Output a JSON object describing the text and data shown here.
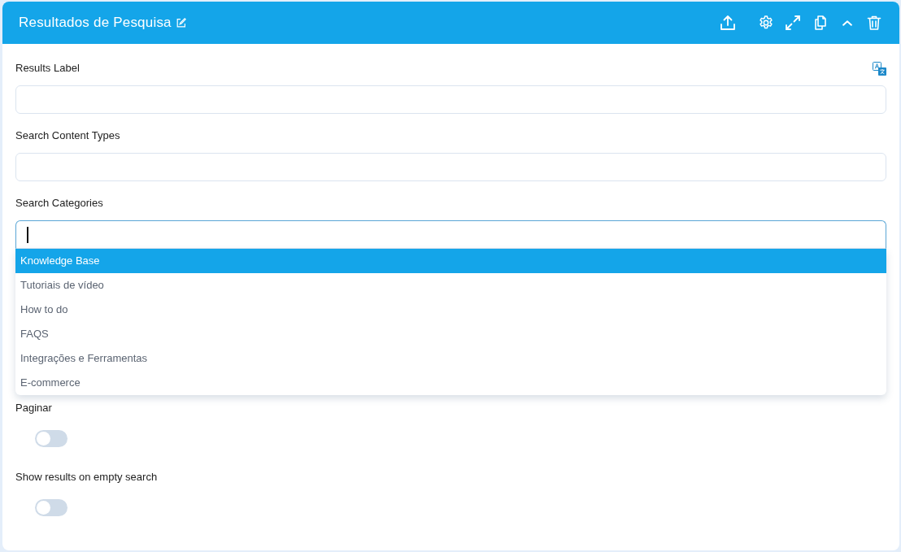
{
  "header": {
    "title": "Resultados de Pesquisa"
  },
  "fields": [
    {
      "kind": "text",
      "label": "Results Label",
      "translate": true
    },
    {
      "kind": "text",
      "label": "Search Content Types",
      "translate": false
    },
    {
      "kind": "select",
      "label": "Search Categories",
      "translate": false,
      "focused": true,
      "options": [
        {
          "label": "Knowledge Base",
          "selected": true
        },
        {
          "label": "Tutoriais de vídeo",
          "selected": false
        },
        {
          "label": "How to do",
          "selected": false
        },
        {
          "label": "FAQS",
          "selected": false
        },
        {
          "label": "Integrações e Ferramentas",
          "selected": false
        },
        {
          "label": "E-commerce",
          "selected": false
        }
      ]
    },
    {
      "kind": "toggle",
      "label": "Paginar",
      "on": false
    },
    {
      "kind": "toggle",
      "label": "Show results on empty search",
      "on": false
    }
  ]
}
